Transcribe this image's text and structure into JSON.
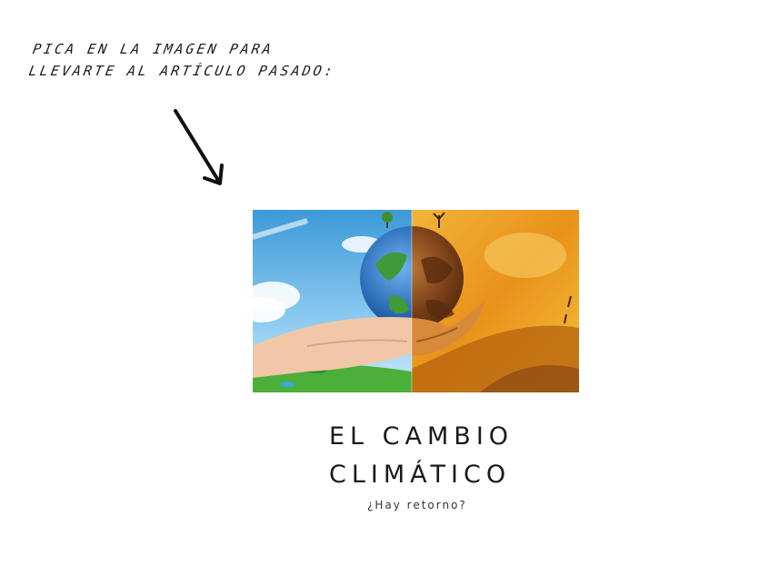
{
  "instruction": {
    "line1": "PICA EN LA IMAGEN PARA",
    "line2": "LLEVARTE AL ARTÍCULO PASADO:"
  },
  "arrow": {
    "icon": "arrow-down-right-icon"
  },
  "image": {
    "icon": "climate-change-hand-globe-image",
    "left_colors": {
      "sky": "#5aaee0",
      "grass": "#4caf3a",
      "globe": "#2f78c4"
    },
    "right_colors": {
      "fire": "#e89a14",
      "scorched": "#a0520f",
      "globe": "#8a4a1c"
    }
  },
  "title": {
    "line1": "EL CAMBIO",
    "line2": "CLIMÁTICO"
  },
  "subtitle": "¿Hay retorno?"
}
